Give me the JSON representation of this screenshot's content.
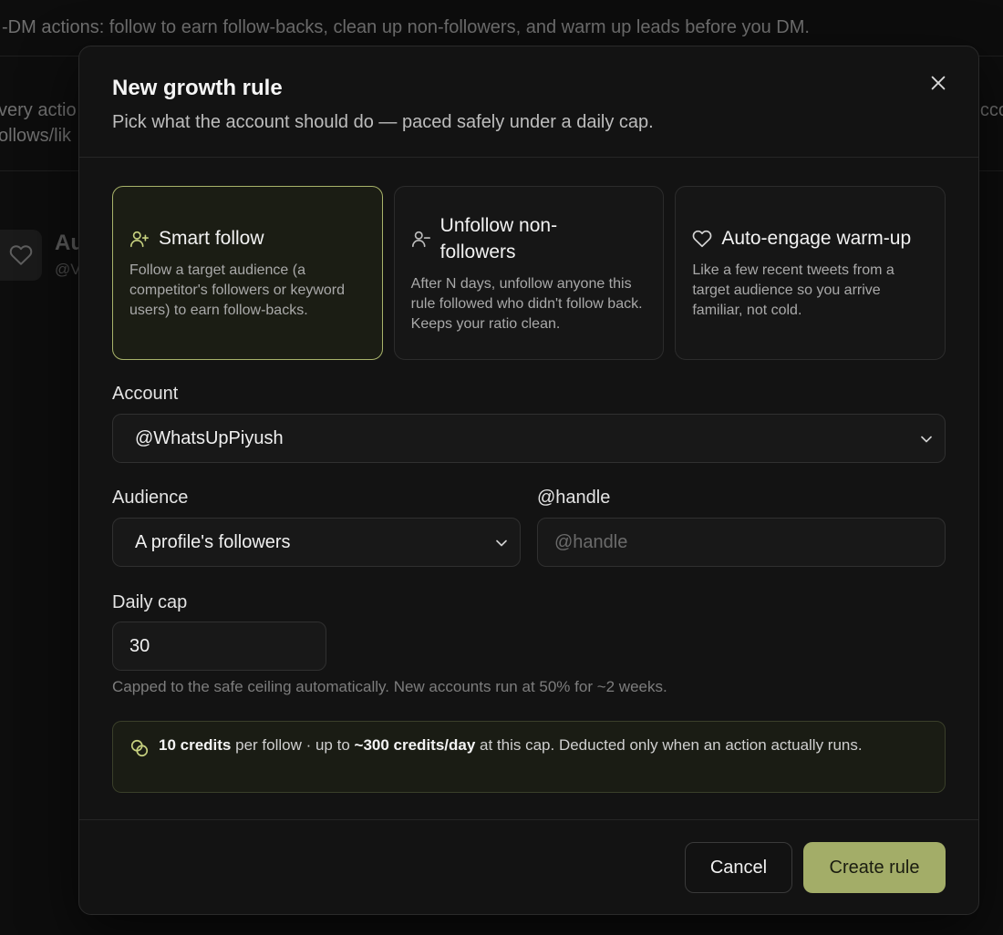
{
  "background": {
    "top_text": "-DM actions: follow to earn follow-backs, clean up non-followers, and warm up leads before you DM.",
    "band_line1": "very actio",
    "band_line2": "ollows/lik",
    "band_right": "cco",
    "card_title": "Au",
    "card_sub": "@V"
  },
  "modal": {
    "title": "New growth rule",
    "subtitle": "Pick what the account should do — paced safely under a daily cap.",
    "options": [
      {
        "title": "Smart follow",
        "desc": "Follow a target audience (a competitor's followers or keyword users) to earn follow-backs.",
        "icon": "user-plus-icon",
        "selected": true
      },
      {
        "title": "Unfollow non-followers",
        "desc": "After N days, unfollow anyone this rule followed who didn't follow back. Keeps your ratio clean.",
        "icon": "user-minus-icon",
        "selected": false
      },
      {
        "title": "Auto-engage warm-up",
        "desc": "Like a few recent tweets from a target audience so you arrive familiar, not cold.",
        "icon": "heart-icon",
        "selected": false
      }
    ],
    "account": {
      "label": "Account",
      "value": "@WhatsUpPiyush"
    },
    "audience": {
      "label": "Audience",
      "value": "A profile's followers"
    },
    "handle": {
      "label": "@handle",
      "placeholder": "@handle"
    },
    "daily_cap": {
      "label": "Daily cap",
      "value": "30",
      "helper": "Capped to the safe ceiling automatically. New accounts run at 50% for ~2 weeks."
    },
    "info": {
      "credits_bold": "10 credits",
      "per_text": " per follow · up to ",
      "cap_bold": "~300 credits/day",
      "rest_text": " at this cap. Deducted only when an action actually runs."
    },
    "footer": {
      "cancel_label": "Cancel",
      "create_label": "Create rule"
    }
  },
  "colors": {
    "accent": "#a3ad68",
    "selected_border": "#a8b36a",
    "background": "#0b0b0b",
    "modal_bg": "#131313"
  }
}
